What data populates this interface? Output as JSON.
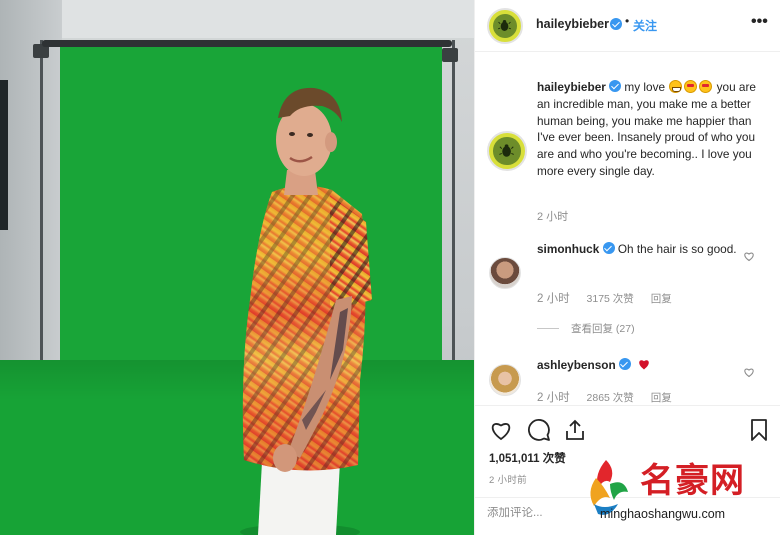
{
  "post": {
    "username": "haileybieber",
    "dot": "•",
    "follow_label": "关注",
    "more_icon": "more-horizontal-icon"
  },
  "caption": {
    "username": "haileybieber",
    "text_1": " my love ",
    "text_2": " you are an incredible man, you make me a better human being, you make me happier than I've ever been. Insanely proud of who you are and who you're becoming.. I love you more every single day.",
    "time": "2 小时"
  },
  "comments": [
    {
      "username": "simonhuck",
      "text": " Oh the hair is so good.",
      "time": "2 小时",
      "likes": "3175 次赞",
      "reply_label": "回复",
      "view_replies": "查看回复 (27)"
    },
    {
      "username": "ashleybenson",
      "text": "",
      "time": "2 小时",
      "likes": "2865 次赞",
      "reply_label": "回复"
    }
  ],
  "actions": {
    "likes": "1,051,011 次赞",
    "time": "2 小时前"
  },
  "comment_box": {
    "placeholder": "添加评论..."
  },
  "watermark": {
    "title": "名豪网",
    "url": "minghaoshangwu.com"
  },
  "colors": {
    "accent": "#3897f0",
    "green_screen": "#19a538",
    "watermark_red": "#d41f25",
    "text": "#262626",
    "muted": "#8e8e8e"
  }
}
